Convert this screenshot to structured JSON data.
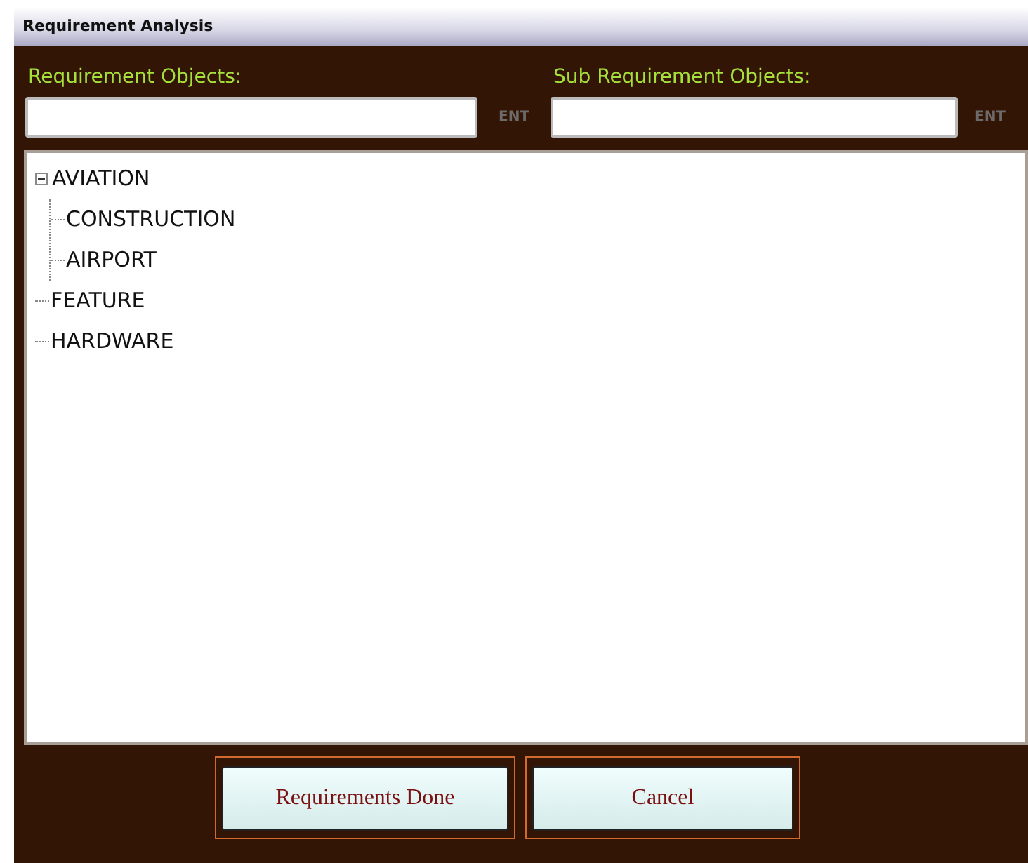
{
  "window": {
    "title": "Requirement Analysis"
  },
  "fields": [
    {
      "label": "Requirement Objects:",
      "button": "ENT"
    },
    {
      "label": "Sub Requirement Objects:",
      "button": "ENT"
    }
  ],
  "tree": [
    {
      "label": "AVIATION",
      "expanded": true,
      "children": [
        {
          "label": "CONSTRUCTION"
        },
        {
          "label": "AIRPORT"
        }
      ]
    },
    {
      "label": "FEATURE"
    },
    {
      "label": "HARDWARE"
    }
  ],
  "buttons": [
    "Requirements Done",
    "Cancel"
  ]
}
